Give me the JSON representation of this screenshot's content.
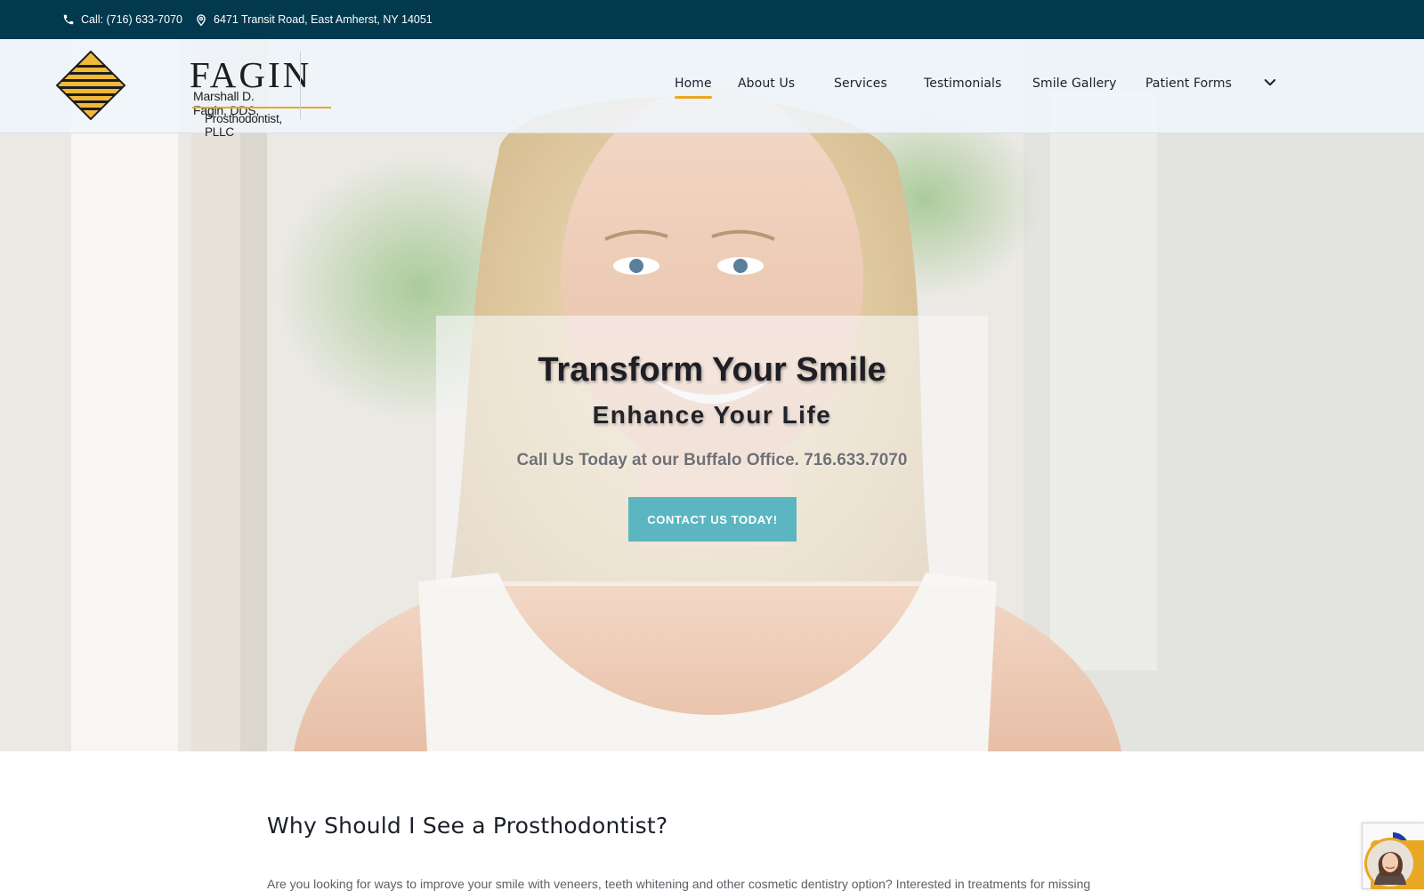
{
  "topbar": {
    "phone_text": "Call: (716) 633-7070",
    "address_text": "6471 Transit Road, East Amherst, NY 14051",
    "phone_icon": "phone-icon",
    "address_icon": "map-pin-icon"
  },
  "logo": {
    "name": "FAGIN",
    "line1": "Marshall D. Fagin, DDS,",
    "line2": "Prosthodontist, PLLC"
  },
  "nav": {
    "items": [
      {
        "label": "Home",
        "active": true
      },
      {
        "label": "About Us"
      },
      {
        "label": "Services"
      },
      {
        "label": "Testimonials"
      },
      {
        "label": "Smile Gallery"
      },
      {
        "label": "Patient Forms"
      }
    ],
    "more_icon": "chevron-down-icon"
  },
  "hero": {
    "title": "Transform Your Smile",
    "subtitle": "Enhance Your Life",
    "phone_line": "Call Us Today at our Buffalo Office. 716.633.7070",
    "cta_label": "CONTACT US TODAY!"
  },
  "content": {
    "heading": "Why Should I See a Prosthodontist?",
    "paragraph": "Are you looking for ways to improve your smile with veneers, teeth whitening and other cosmetic dentistry option? Interested in treatments for missing"
  },
  "colors": {
    "topbar_bg": "#02394f",
    "accent_gold": "#e9a823",
    "cta_teal": "#5bb6c1"
  }
}
